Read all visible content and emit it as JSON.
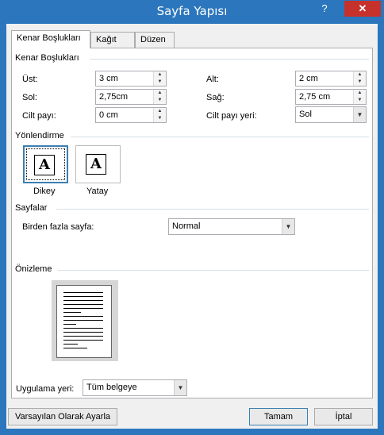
{
  "window": {
    "title": "Sayfa Yapısı",
    "help": "?",
    "close": "✕"
  },
  "tabs": [
    {
      "label": "Kenar Boşlukları",
      "active": true
    },
    {
      "label": "Kağıt",
      "active": false
    },
    {
      "label": "Düzen",
      "active": false
    }
  ],
  "margins": {
    "section_title": "Kenar Boşlukları",
    "top_label": "Üst:",
    "top_value": "3 cm",
    "bottom_label": "Alt:",
    "bottom_value": "2 cm",
    "left_label": "Sol:",
    "left_value": "2,75cm",
    "right_label": "Sağ:",
    "right_value": "2,75 cm",
    "gutter_label": "Cilt payı:",
    "gutter_value": "0 cm",
    "gutter_pos_label": "Cilt payı yeri:",
    "gutter_pos_value": "Sol"
  },
  "orientation": {
    "section_title": "Yönlendirme",
    "portrait_label": "Dikey",
    "landscape_label": "Yatay",
    "icon_letter": "A",
    "selected": "Dikey"
  },
  "pages": {
    "section_title": "Sayfalar",
    "multiple_label": "Birden fazla sayfa:",
    "multiple_value": "Normal"
  },
  "preview": {
    "section_title": "Önizleme"
  },
  "apply": {
    "label": "Uygulama yeri:",
    "value": "Tüm belgeye"
  },
  "buttons": {
    "default": "Varsayılan Olarak Ayarla",
    "ok": "Tamam",
    "cancel": "İptal"
  }
}
